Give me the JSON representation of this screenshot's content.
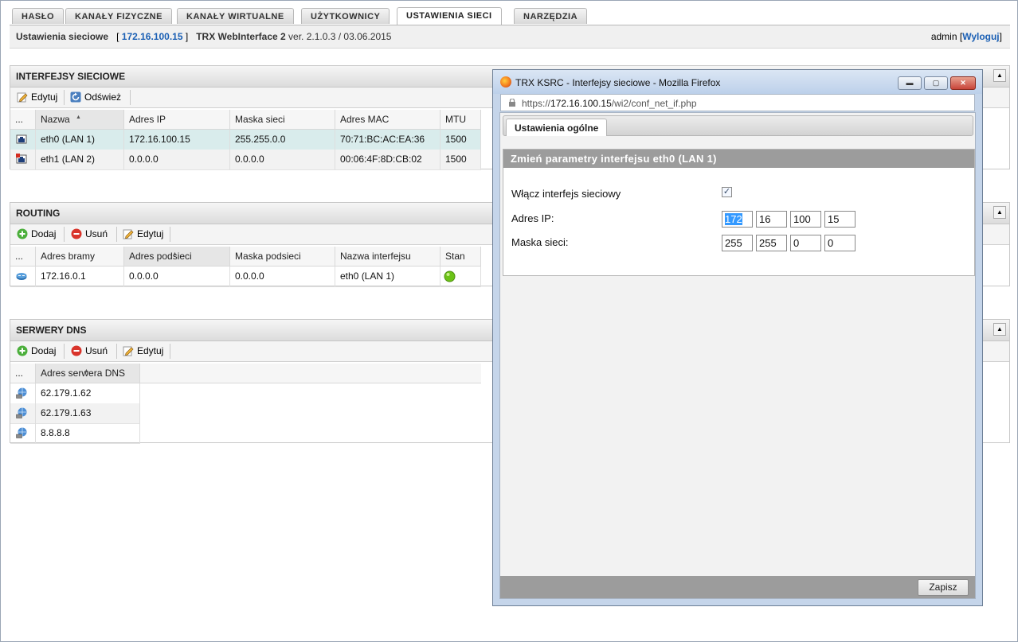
{
  "tabs": [
    "HASŁO",
    "KANAŁY FIZYCZNE",
    "KANAŁY WIRTUALNE",
    "UŻYTKOWNICY",
    "USTAWIENIA SIECI",
    "NARZĘDZIA"
  ],
  "info": {
    "section": "Ustawienia sieciowe",
    "bracket_open": "[",
    "ip": "172.16.100.15",
    "bracket_close": "]",
    "product": "TRX WebInterface 2",
    "version": "ver. 2.1.0.3 / 03.06.2015",
    "user": "admin",
    "logout_open": "[",
    "logout": "Wyloguj",
    "logout_close": "]"
  },
  "interfaces": {
    "title": "INTERFEJSY SIECIOWE",
    "toolbar": {
      "edit": "Edytuj",
      "refresh": "Odśwież"
    },
    "columns": [
      "...",
      "Nazwa",
      "Adres IP",
      "Maska sieci",
      "Adres MAC",
      "MTU"
    ],
    "rows": [
      {
        "name": "eth0 (LAN 1)",
        "ip": "172.16.100.15",
        "mask": "255.255.0.0",
        "mac": "70:71:BC:AC:EA:36",
        "mtu": "1500"
      },
      {
        "name": "eth1 (LAN 2)",
        "ip": "0.0.0.0",
        "mask": "0.0.0.0",
        "mac": "00:06:4F:8D:CB:02",
        "mtu": "1500"
      }
    ]
  },
  "routing": {
    "title": "ROUTING",
    "toolbar": {
      "add": "Dodaj",
      "remove": "Usuń",
      "edit": "Edytuj"
    },
    "columns": [
      "...",
      "Adres bramy",
      "Adres podsieci",
      "Maska podsieci",
      "Nazwa interfejsu",
      "Stan"
    ],
    "rows": [
      {
        "gateway": "172.16.0.1",
        "subnet": "0.0.0.0",
        "mask": "0.0.0.0",
        "iface": "eth0 (LAN 1)",
        "status_color": "#6cc317"
      }
    ]
  },
  "dns": {
    "title": "SERWERY DNS",
    "toolbar": {
      "add": "Dodaj",
      "remove": "Usuń",
      "edit": "Edytuj"
    },
    "columns": [
      "...",
      "Adres serwera DNS"
    ],
    "rows": [
      "62.179.1.62",
      "62.179.1.63",
      "8.8.8.8"
    ]
  },
  "popup": {
    "title": "TRX KSRC - Interfejsy sieciowe - Mozilla Firefox",
    "url_prefix": "https://",
    "url_host": "172.16.100.15",
    "url_path": "/wi2/conf_net_if.php",
    "tab": "Ustawienia ogólne",
    "form_title": "Zmień parametry interfejsu eth0 (LAN 1)",
    "enable_label": "Włącz interfejs sieciowy",
    "enable_checked": "✓",
    "ip_label": "Adres IP:",
    "ip": [
      "172",
      "16",
      "100",
      "15"
    ],
    "mask_label": "Maska sieci:",
    "mask": [
      "255",
      "255",
      "0",
      "0"
    ],
    "save": "Zapisz"
  }
}
